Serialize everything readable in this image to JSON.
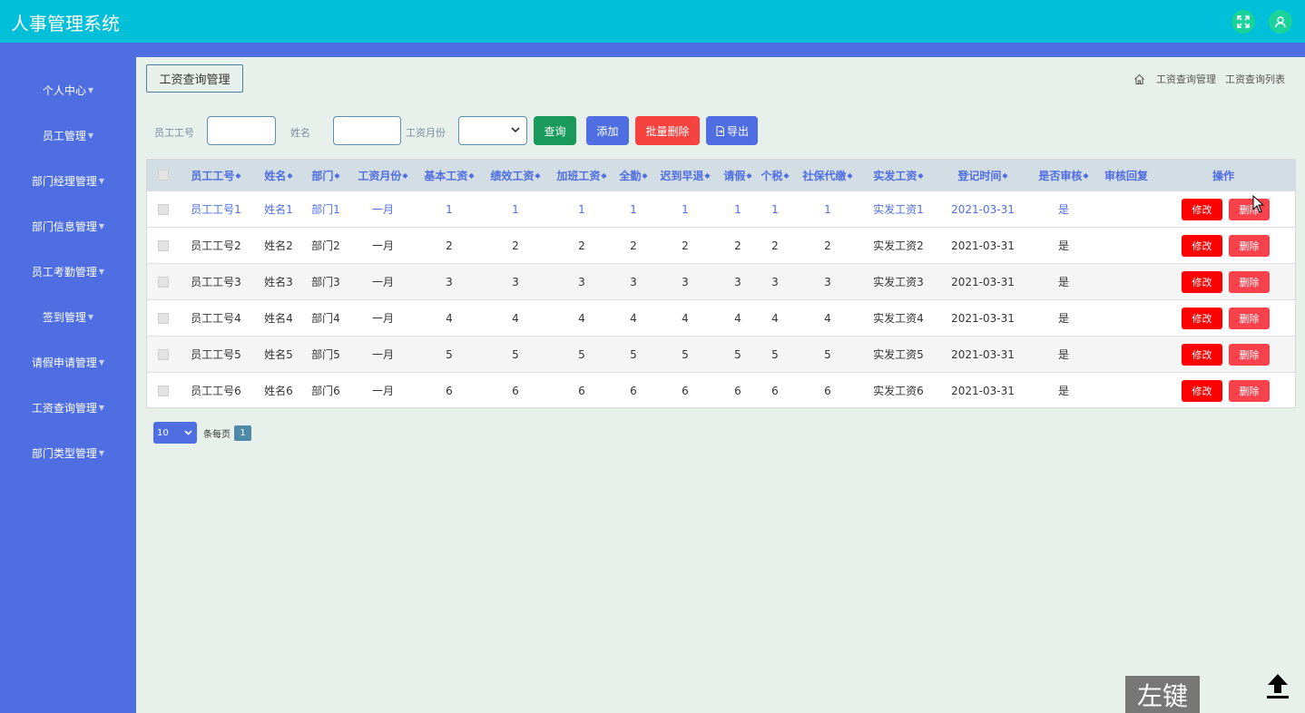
{
  "app": {
    "title": "人事管理系统"
  },
  "header": {
    "icons": [
      "fullscreen-icon",
      "user-icon"
    ]
  },
  "sidebar": {
    "items": [
      {
        "label": "个人中心"
      },
      {
        "label": "员工管理"
      },
      {
        "label": "部门经理管理"
      },
      {
        "label": "部门信息管理"
      },
      {
        "label": "员工考勤管理"
      },
      {
        "label": "签到管理"
      },
      {
        "label": "请假申请管理"
      },
      {
        "label": "工资查询管理"
      },
      {
        "label": "部门类型管理"
      }
    ]
  },
  "page": {
    "title_button": "工资查询管理",
    "breadcrumb": [
      "工资查询管理",
      "工资查询列表"
    ]
  },
  "search": {
    "employee_no_label": "员工工号",
    "employee_no_value": "",
    "name_label": "姓名",
    "name_value": "",
    "month_label": "工资月份",
    "month_value": ""
  },
  "toolbar": {
    "query": "查询",
    "add": "添加",
    "batch_delete": "批量删除",
    "export": "导出"
  },
  "table": {
    "columns": [
      "员工工号",
      "姓名",
      "部门",
      "工资月份",
      "基本工资",
      "绩效工资",
      "加班工资",
      "全勤",
      "迟到早退",
      "请假",
      "个税",
      "社保代缴",
      "实发工资",
      "登记时间",
      "是否审核",
      "审核回复",
      "操作"
    ],
    "rows": [
      {
        "employee_no": "员工工号1",
        "name": "姓名1",
        "dept": "部门1",
        "month": "一月",
        "base": "1",
        "perf": "1",
        "overtime": "1",
        "attendance": "1",
        "late": "1",
        "leave": "1",
        "tax": "1",
        "social": "1",
        "net": "实发工资1",
        "date": "2021-03-31",
        "audited": "是",
        "reply": ""
      },
      {
        "employee_no": "员工工号2",
        "name": "姓名2",
        "dept": "部门2",
        "month": "一月",
        "base": "2",
        "perf": "2",
        "overtime": "2",
        "attendance": "2",
        "late": "2",
        "leave": "2",
        "tax": "2",
        "social": "2",
        "net": "实发工资2",
        "date": "2021-03-31",
        "audited": "是",
        "reply": ""
      },
      {
        "employee_no": "员工工号3",
        "name": "姓名3",
        "dept": "部门3",
        "month": "一月",
        "base": "3",
        "perf": "3",
        "overtime": "3",
        "attendance": "3",
        "late": "3",
        "leave": "3",
        "tax": "3",
        "social": "3",
        "net": "实发工资3",
        "date": "2021-03-31",
        "audited": "是",
        "reply": ""
      },
      {
        "employee_no": "员工工号4",
        "name": "姓名4",
        "dept": "部门4",
        "month": "一月",
        "base": "4",
        "perf": "4",
        "overtime": "4",
        "attendance": "4",
        "late": "4",
        "leave": "4",
        "tax": "4",
        "social": "4",
        "net": "实发工资4",
        "date": "2021-03-31",
        "audited": "是",
        "reply": ""
      },
      {
        "employee_no": "员工工号5",
        "name": "姓名5",
        "dept": "部门5",
        "month": "一月",
        "base": "5",
        "perf": "5",
        "overtime": "5",
        "attendance": "5",
        "late": "5",
        "leave": "5",
        "tax": "5",
        "social": "5",
        "net": "实发工资5",
        "date": "2021-03-31",
        "audited": "是",
        "reply": ""
      },
      {
        "employee_no": "员工工号6",
        "name": "姓名6",
        "dept": "部门6",
        "month": "一月",
        "base": "6",
        "perf": "6",
        "overtime": "6",
        "attendance": "6",
        "late": "6",
        "leave": "6",
        "tax": "6",
        "social": "6",
        "net": "实发工资6",
        "date": "2021-03-31",
        "audited": "是",
        "reply": ""
      }
    ],
    "edit_label": "修改",
    "delete_label": "删除"
  },
  "pager": {
    "page_size": "10",
    "per_page_label": "条每页",
    "current_page": "1"
  },
  "overlay": {
    "key_label": "左键"
  },
  "colors": {
    "header": "#00c0d9",
    "sidebar": "#4f6ee1",
    "accent": "#4f6ee1",
    "danger": "#ff0000",
    "success": "#1a9a5a"
  }
}
